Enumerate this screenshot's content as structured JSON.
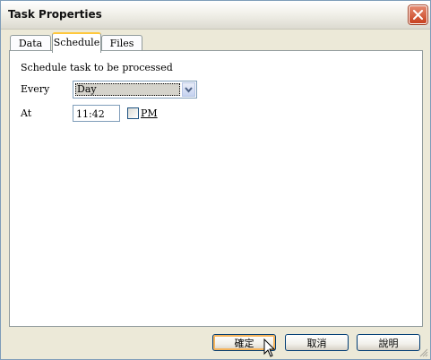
{
  "window": {
    "title": "Task Properties"
  },
  "tabs": [
    {
      "label": "Data",
      "active": false
    },
    {
      "label": "Schedule",
      "active": true
    },
    {
      "label": "Files",
      "active": false
    }
  ],
  "schedule": {
    "heading": "Schedule task to be processed",
    "every_label": "Every",
    "every_value": "Day",
    "at_label": "At",
    "time_value": "11:42",
    "pm_label": "PM",
    "pm_checked": false
  },
  "buttons": {
    "ok": "確定",
    "cancel": "取消",
    "help": "說明"
  },
  "icons": {
    "close": "close-icon",
    "dropdown": "chevron-down-icon",
    "cursor": "mouse-pointer-icon",
    "grip": "resize-grip-icon"
  },
  "colors": {
    "close_button": "#c8411f",
    "active_tab_accent": "#ffc83c",
    "border": "#7f9db9"
  }
}
